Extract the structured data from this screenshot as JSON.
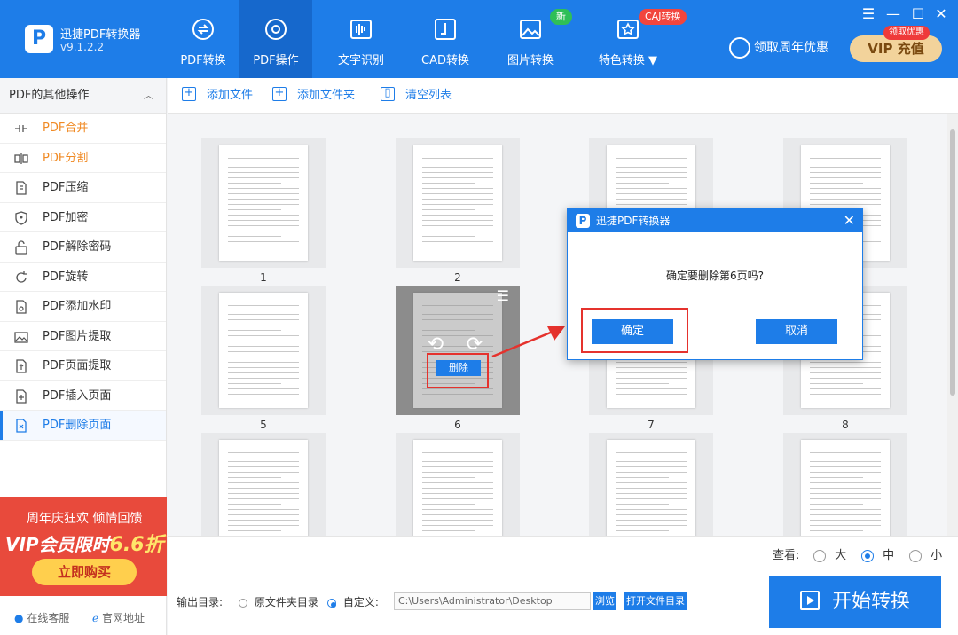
{
  "app": {
    "name": "迅捷PDF转换器",
    "version": "v9.1.2.2",
    "logo_letter": "P"
  },
  "nav": [
    {
      "label": "PDF转换",
      "icon": "convert-icon"
    },
    {
      "label": "PDF操作",
      "icon": "gear-icon",
      "active": true
    },
    {
      "label": "文字识别",
      "icon": "ocr-icon"
    },
    {
      "label": "CAD转换",
      "icon": "cad-icon"
    },
    {
      "label": "图片转换",
      "icon": "image-icon",
      "badge": "新"
    },
    {
      "label": "特色转换 ▼",
      "icon": "star-icon",
      "badge": "CAJ转换"
    }
  ],
  "header": {
    "promo_link": "领取周年优惠",
    "vip_button": "VIP 充值",
    "vip_badge": "领取优惠",
    "window_controls": [
      "☰",
      "—",
      "☐",
      "✕"
    ]
  },
  "sidebar": {
    "header": "PDF的其他操作",
    "items": [
      {
        "label": "PDF合并",
        "icon": "merge-icon",
        "state": "orange"
      },
      {
        "label": "PDF分割",
        "icon": "split-icon",
        "state": "orange"
      },
      {
        "label": "PDF压缩",
        "icon": "compress-icon"
      },
      {
        "label": "PDF加密",
        "icon": "shield-icon"
      },
      {
        "label": "PDF解除密码",
        "icon": "unlock-icon"
      },
      {
        "label": "PDF旋转",
        "icon": "rotate-icon"
      },
      {
        "label": "PDF添加水印",
        "icon": "watermark-icon"
      },
      {
        "label": "PDF图片提取",
        "icon": "image-extract-icon"
      },
      {
        "label": "PDF页面提取",
        "icon": "page-extract-icon"
      },
      {
        "label": "PDF插入页面",
        "icon": "insert-page-icon"
      },
      {
        "label": "PDF删除页面",
        "icon": "delete-page-icon",
        "state": "active"
      }
    ],
    "promo": {
      "line1": "周年庆狂欢 倾情回馈",
      "line2": "VIP会员限时",
      "line2_highlight": "6.6折",
      "button": "立即购买"
    },
    "footer": {
      "service": "在线客服",
      "website": "官网地址"
    }
  },
  "toolbar": {
    "add_file": "添加文件",
    "add_folder": "添加文件夹",
    "clear_list": "清空列表"
  },
  "pages": [
    "1",
    "2",
    "",
    "",
    "5",
    "6",
    "7",
    "8",
    "",
    "",
    "",
    ""
  ],
  "selected_page": {
    "delete_label": "删除",
    "rotate_left": "⟲",
    "rotate_right": "⟳",
    "menu_icon": "☰"
  },
  "dialog": {
    "title": "迅捷PDF转换器",
    "message": "确定要删除第6页吗?",
    "confirm": "确定",
    "cancel": "取消",
    "close": "✕"
  },
  "view": {
    "label": "查看:",
    "options": [
      "大",
      "中",
      "小"
    ],
    "selected": "中"
  },
  "output": {
    "label": "输出目录:",
    "option_source": "原文件夹目录",
    "option_custom": "自定义:",
    "selected": "自定义:",
    "path": "C:\\Users\\Administrator\\Desktop",
    "browse": "浏览",
    "open_folder": "打开文件目录",
    "start": "开始转换"
  },
  "colors": {
    "primary": "#1e7de8",
    "accent_orange": "#f08a24",
    "highlight_red": "#e5322d"
  }
}
